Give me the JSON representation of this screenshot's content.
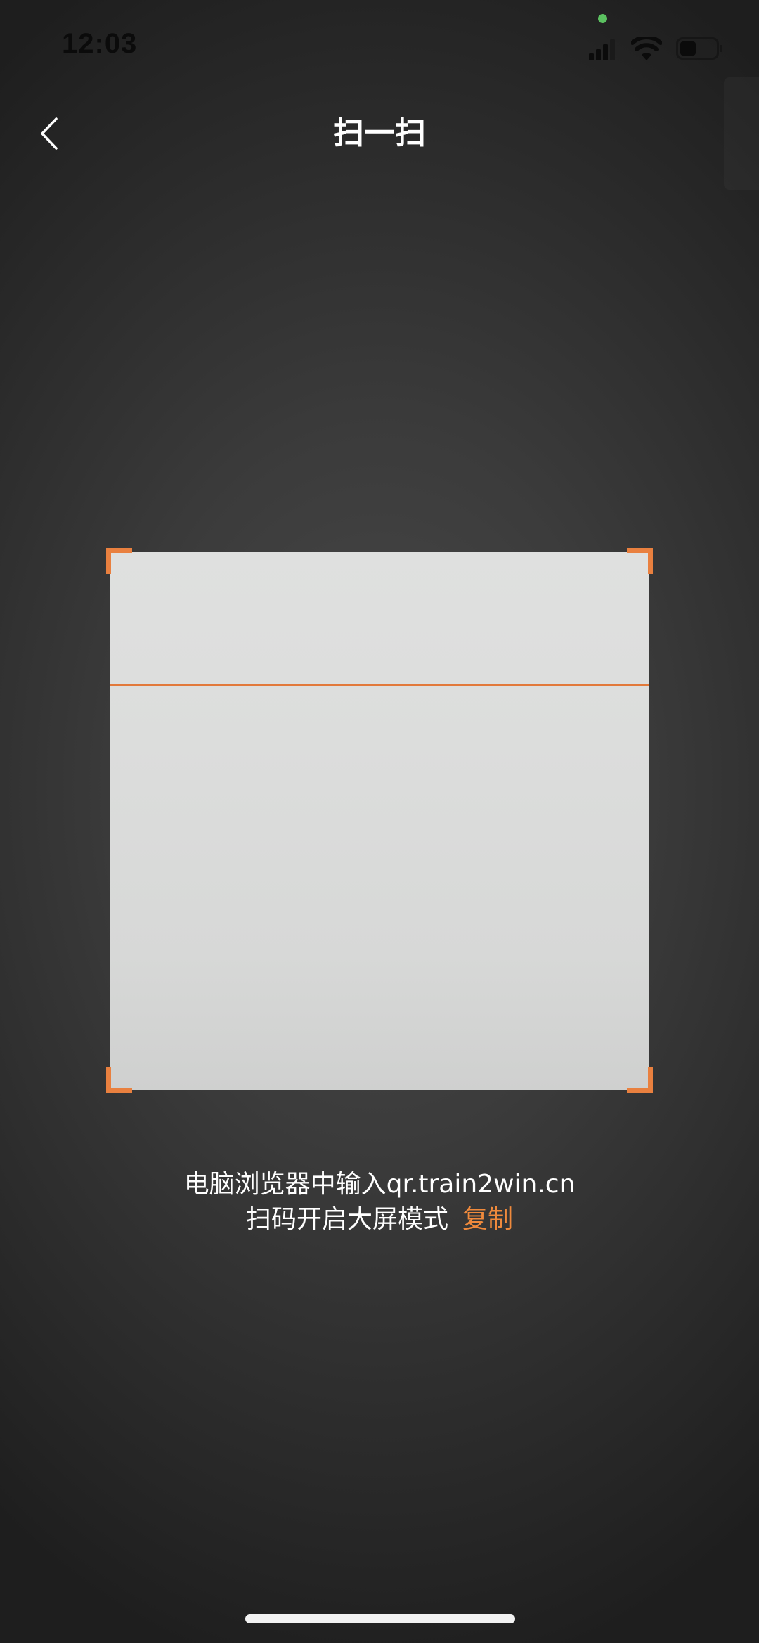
{
  "status_bar": {
    "time": "12:03",
    "privacy_dot_color": "#5bc160",
    "icons": [
      "cellular-signal-icon",
      "wifi-icon",
      "battery-icon"
    ]
  },
  "nav": {
    "back_icon": "chevron-left-icon",
    "title": "扫一扫"
  },
  "scanner": {
    "accent_color": "#e9803f",
    "corner_icons": [
      "corner-bracket-top-left",
      "corner-bracket-top-right",
      "corner-bracket-bottom-left",
      "corner-bracket-bottom-right"
    ]
  },
  "hint": {
    "line1": "电脑浏览器中输入qr.train2win.cn",
    "line2": "扫码开启大屏模式",
    "copy_label": "复制",
    "copy_color": "#f08a3c"
  }
}
